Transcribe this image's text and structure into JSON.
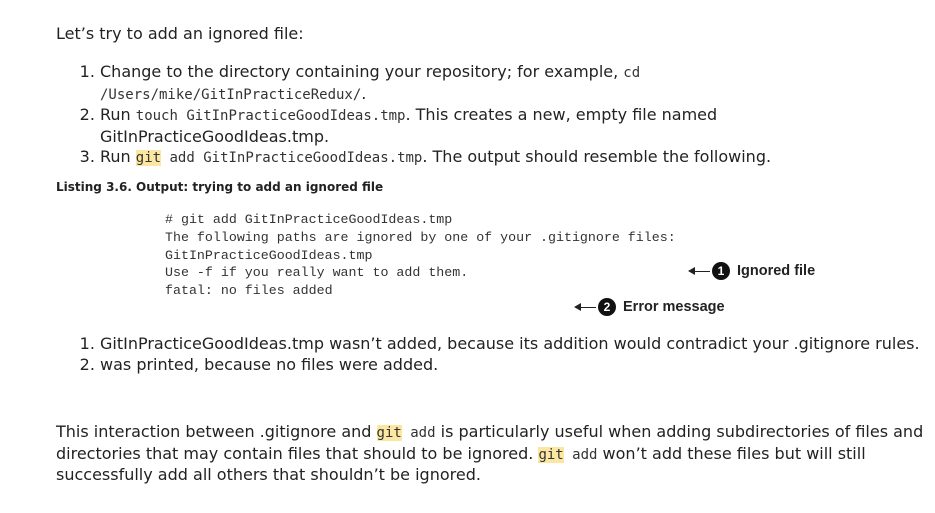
{
  "intro": "Let’s try to add an ignored file:",
  "steps": [
    {
      "text_a": "Change to the directory containing your repository; for example, ",
      "code_a": "cd /Users/mike/GitInPracticeRedux/",
      "text_b": "."
    },
    {
      "text_a": "Run ",
      "code_a": "touch GitInPracticeGoodIdeas.tmp",
      "text_b": ". This creates a new, empty file named GitInPracticeGoodIdeas.tmp."
    },
    {
      "text_a": "Run ",
      "git": "git",
      "code_a": " add GitInPracticeGoodIdeas.tmp",
      "text_b": ". The output should resemble the following."
    }
  ],
  "listing": {
    "caption": "Listing 3.6. Output: trying to add an ignored file",
    "lines": [
      "# git add GitInPracticeGoodIdeas.tmp",
      "",
      "The following paths are ignored by one of your .gitignore files:",
      "GitInPracticeGoodIdeas.tmp",
      "Use -f if you really want to add them.",
      "fatal: no files added"
    ],
    "callouts": [
      {
        "number": "1",
        "label": "Ignored file"
      },
      {
        "number": "2",
        "label": "Error message"
      }
    ]
  },
  "results": [
    "GitInPracticeGoodIdeas.tmp wasn’t added, because its addition would contradict your .gitignore rules.",
    "was printed, because no files were added."
  ],
  "closing": {
    "t1": "This interaction between .gitignore and ",
    "git1": "git",
    "c1": " add",
    "t2": " is particularly useful when adding subdirectories of files and directories that may contain files that should to be ignored. ",
    "git2": "git",
    "c2": " add",
    "t3": " won’t add these files but will still successfully add all others that shouldn’t be ignored."
  },
  "colors": {
    "highlight": "#fbe6a2",
    "text": "#222222"
  }
}
